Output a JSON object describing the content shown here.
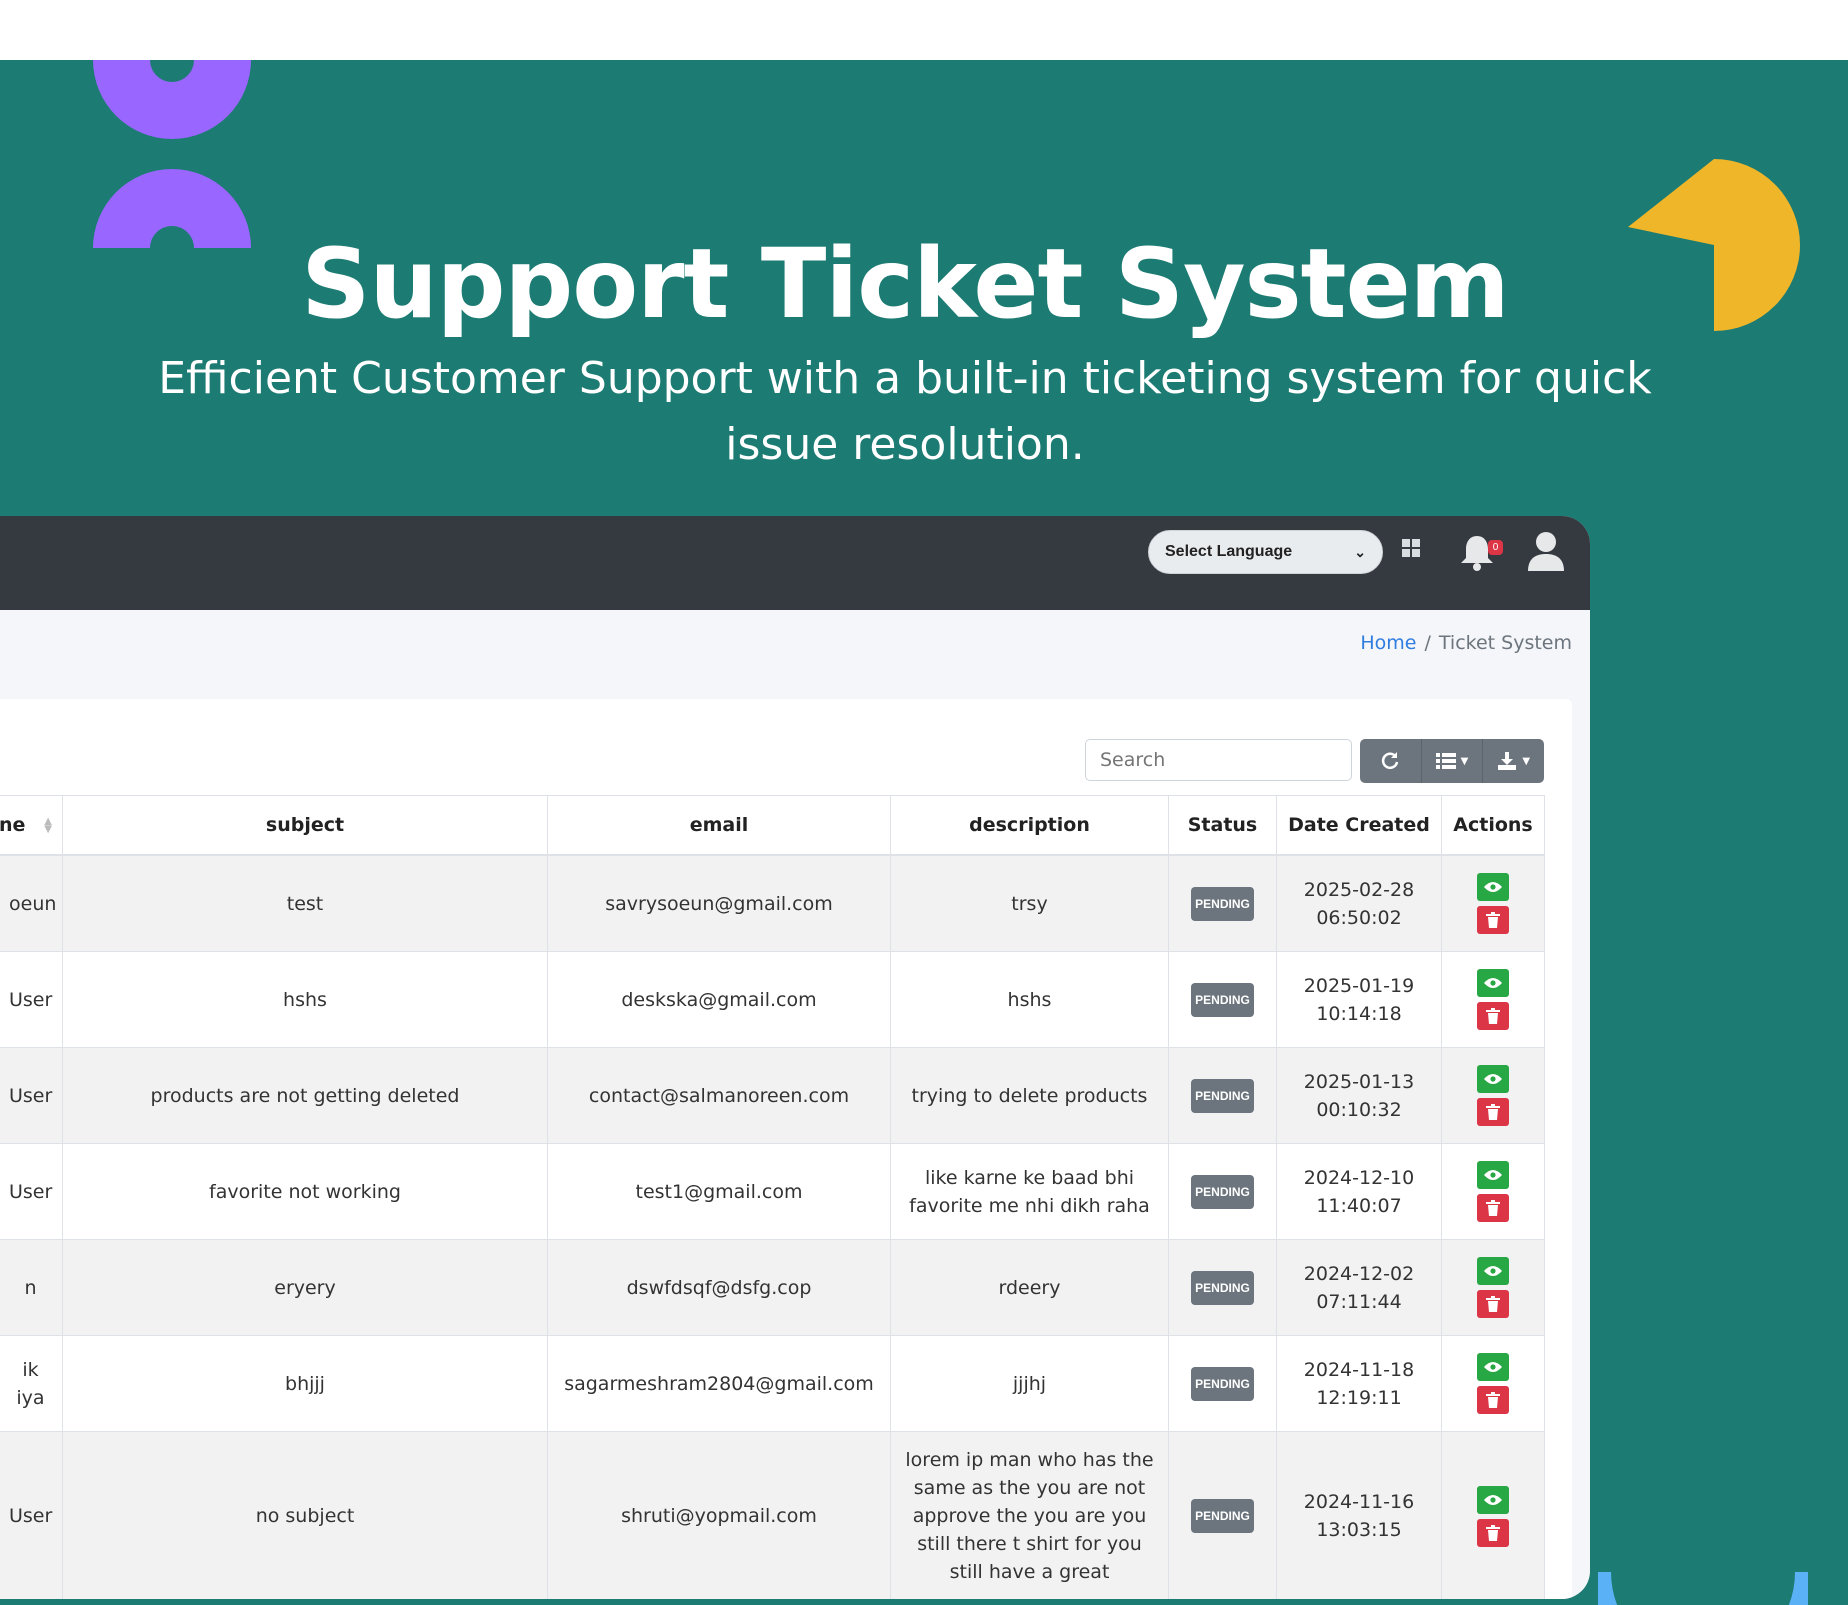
{
  "hero": {
    "title": "Support Ticket System",
    "subtitle_line1": "Efficient Customer Support with a built-in ticketing system for quick",
    "subtitle_line2": "issue resolution."
  },
  "colors": {
    "banner_bg": "#1c7b72",
    "topbar_bg": "#343a40",
    "deco_purple": "#9966ff",
    "deco_yellow": "#f0b62a",
    "deco_blue": "#5ab1f5",
    "badge_bg": "#6c757d",
    "view_button": "#28a745",
    "delete_button": "#dc3545"
  },
  "topbar": {
    "language_select": "Select Language",
    "notification_count": "0",
    "icons": [
      "grid-icon",
      "bell-icon",
      "user-icon"
    ]
  },
  "breadcrumb": {
    "home": "Home",
    "separator": "/",
    "current": "Ticket System"
  },
  "toolbar": {
    "search_placeholder": "Search",
    "buttons": [
      "refresh-icon",
      "columns-icon",
      "export-icon"
    ]
  },
  "table": {
    "columns": [
      "ne",
      "subject",
      "email",
      "description",
      "Status",
      "Date Created",
      "Actions"
    ],
    "rows": [
      {
        "name": "oeun",
        "subject": "test",
        "email": "savrysoeun@gmail.com",
        "description": "trsy",
        "status": "PENDING",
        "date": "2025-02-28",
        "time": "06:50:02"
      },
      {
        "name": "User",
        "subject": "hshs",
        "email": "deskska@gmail.com",
        "description": "hshs",
        "status": "PENDING",
        "date": "2025-01-19",
        "time": "10:14:18"
      },
      {
        "name": "User",
        "subject": "products are not getting deleted",
        "email": "contact@salmanoreen.com",
        "description": "trying to delete products",
        "status": "PENDING",
        "date": "2025-01-13",
        "time": "00:10:32"
      },
      {
        "name": "User",
        "subject": "favorite not working",
        "email": "test1@gmail.com",
        "description": "like karne ke baad bhi favorite me nhi dikh raha",
        "status": "PENDING",
        "date": "2024-12-10",
        "time": "11:40:07"
      },
      {
        "name": "n",
        "subject": "eryery",
        "email": "dswfdsqf@dsfg.cop",
        "description": "rdeery",
        "status": "PENDING",
        "date": "2024-12-02",
        "time": "07:11:44"
      },
      {
        "name": "ik iya",
        "subject": "bhjjj",
        "email": "sagarmeshram2804@gmail.com",
        "description": "jjjhj",
        "status": "PENDING",
        "date": "2024-11-18",
        "time": "12:19:11"
      },
      {
        "name": "User",
        "subject": "no subject",
        "email": "shruti@yopmail.com",
        "description": "lorem ip man who has the same as the you are not approve the you are you still there t shirt for you still have a great",
        "status": "PENDING",
        "date": "2024-11-16",
        "time": "13:03:15"
      }
    ]
  }
}
